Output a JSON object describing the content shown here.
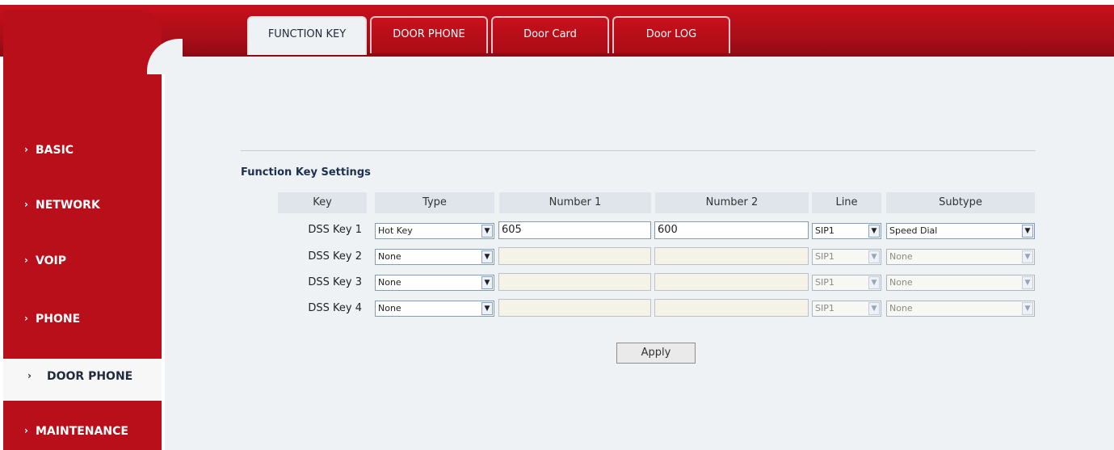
{
  "tabs": [
    {
      "label": "FUNCTION KEY",
      "active": true
    },
    {
      "label": "DOOR PHONE",
      "active": false
    },
    {
      "label": "Door Card",
      "active": false
    },
    {
      "label": "Door LOG",
      "active": false
    }
  ],
  "sidebar": {
    "items": [
      {
        "label": "BASIC",
        "active": false
      },
      {
        "label": "NETWORK",
        "active": false
      },
      {
        "label": "VOIP",
        "active": false
      },
      {
        "label": "PHONE",
        "active": false
      },
      {
        "label": "DOOR PHONE",
        "active": true
      },
      {
        "label": "MAINTENANCE",
        "active": false
      }
    ],
    "chevron": "›"
  },
  "section_title": "Function Key Settings",
  "table": {
    "headers": [
      "Key",
      "Type",
      "Number 1",
      "Number 2",
      "Line",
      "Subtype"
    ],
    "rows": [
      {
        "key": "DSS Key 1",
        "type": "Hot Key",
        "number1": "605",
        "number2": "600",
        "line": "SIP1",
        "subtype": "Speed Dial"
      },
      {
        "key": "DSS Key 2",
        "type": "None",
        "number1": "",
        "number2": "",
        "line": "SIP1",
        "subtype": "None"
      },
      {
        "key": "DSS Key 3",
        "type": "None",
        "number1": "",
        "number2": "",
        "line": "SIP1",
        "subtype": "None"
      },
      {
        "key": "DSS Key 4",
        "type": "None",
        "number1": "",
        "number2": "",
        "line": "SIP1",
        "subtype": "None"
      }
    ]
  },
  "apply_label": "Apply",
  "colors": {
    "brand_red": "#b90f1a",
    "panel_bg": "#eef2f4"
  }
}
